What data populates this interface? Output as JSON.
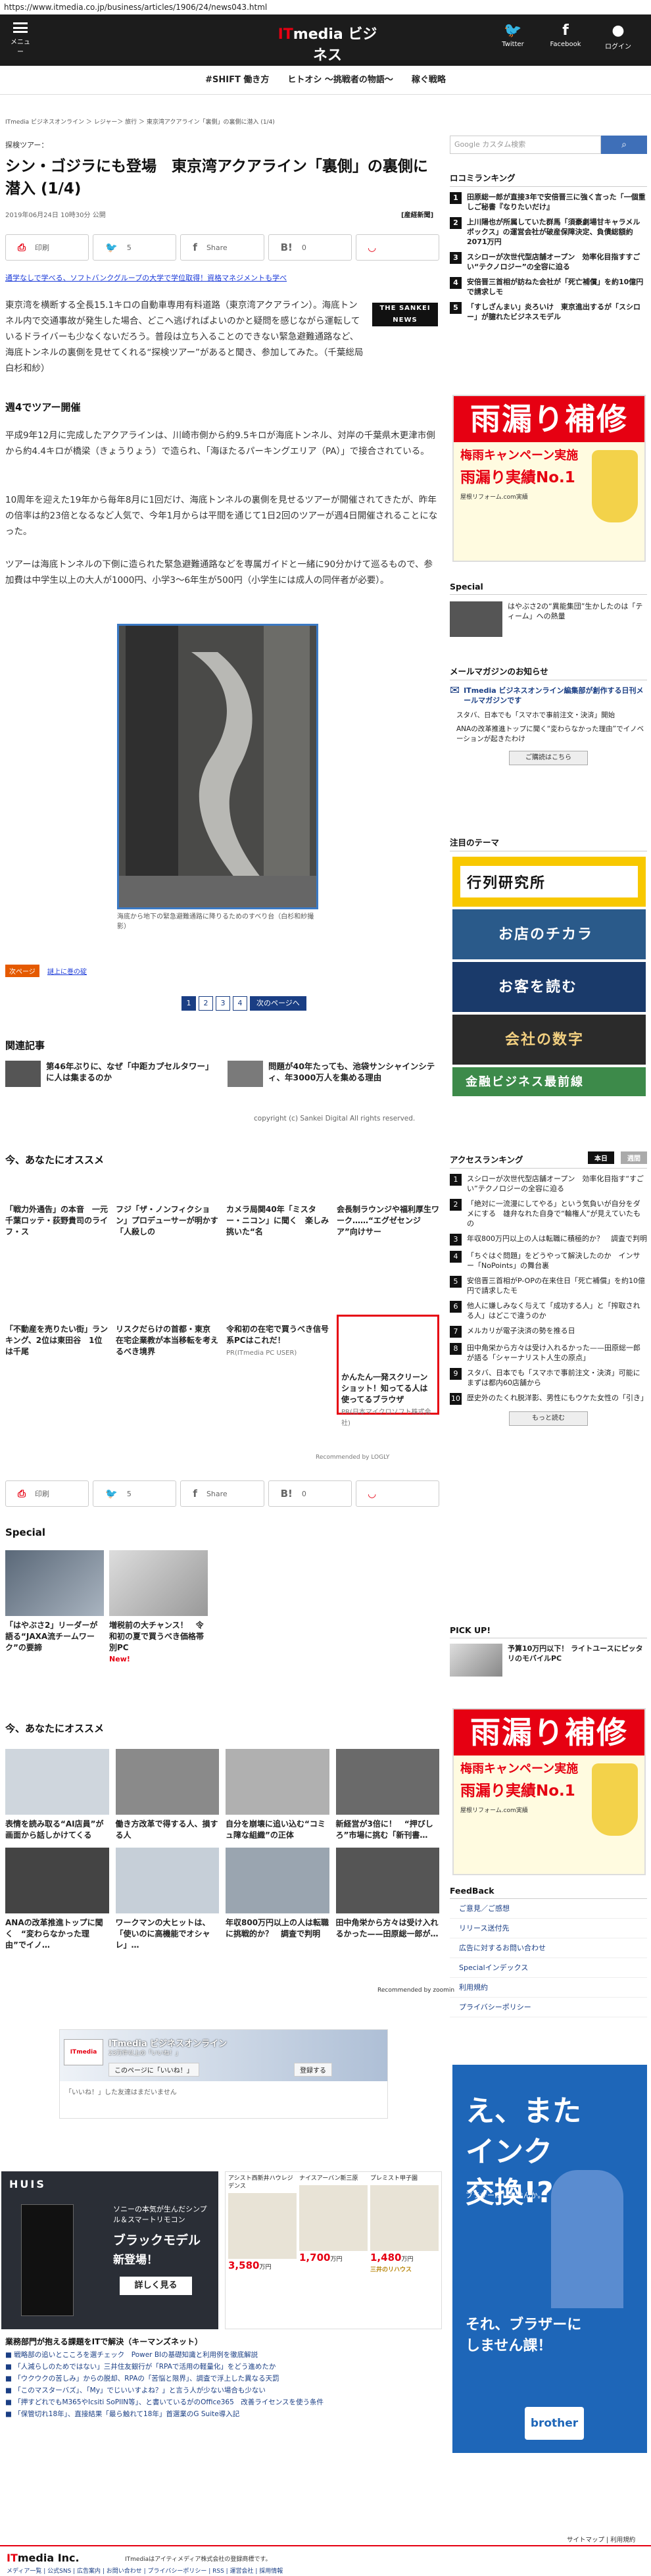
{
  "url": "https://www.itmedia.co.jp/business/articles/1906/24/news043.html",
  "header": {
    "menu": "メニュー",
    "logo_it": "IT",
    "logo_rest": "media ビジネス",
    "logo_sub": "ONLINE",
    "twitter": "Twitter",
    "facebook": "Facebook",
    "login": "ログイン"
  },
  "subnav": [
    "#SHIFT 働き方",
    "ヒトオシ 〜挑戦者の物語〜",
    "稼ぐ戦略"
  ],
  "breadcrumb": "ITmedia ビジネスオンライン ＞ レジャー＞ 旅行 ＞ 東京湾アクアライン「裏側」の裏側に潜入 (1/4)",
  "article": {
    "category": "探検ツアー：",
    "title": "シン・ゴジラにも登場　東京湾アクアライン「裏側」の裏側に潜入 (1/4)",
    "date": "2019年06月24日 10時30分 公開",
    "print_label": "[産経新聞]",
    "share": {
      "print": "印刷",
      "tw_count": "5",
      "fb": "Share",
      "hb": "0"
    },
    "promo_link": "通学なしで学べる、ソフトバンクグループの大学で学位取得！資格マネジメントも学べ",
    "lead": "東京湾を横断する全長15.1キロの自動車専用有料道路（東京湾アクアライン）。海底トンネル内で交通事故が発生した場合、どこへ逃げればよいのかと疑問を感じながら運転しているドライバーも少なくないだろう。普段は立ち入ることのできない緊急避難通路など、海底トンネルの裏側を見せてくれる“探検ツアー”があると聞き、参加してみた。（千葉総局　白杉和紗）",
    "sankei": "THE SANKEI NEWS",
    "h_section": "週4でツアー開催",
    "p1": "平成9年12月に完成したアクアラインは、川崎市側から約9.5キロが海底トンネル、対岸の千葉県木更津市側から約4.4キロが橋梁（きょうりょう）で造られ、「海ほたるパーキングエリア（PA）」で接合されている。",
    "p2": "10周年を迎えた19年から毎年8月に1回だけ、海底トンネルの裏側を見せるツアーが開催されてきたが、昨年の倍率は約23倍となるなど人気で、今年1月からは平間を通じて1日2回のツアーが週4日開催されることになった。",
    "p3": "ツアーは海底トンネルの下側に造られた緊急避難通路などを専属ガイドと一緒に90分かけて巡るもので、参加費は中学生以上の大人が1000円、小学3〜6年生が500円（小学生には成人の同伴者が必要）。",
    "caption": "海底から地下の緊急避難通路に降りるためのすべり台（白杉和紗撮影）",
    "next_tag": "次ページ",
    "next_link": "謎上に巻の碇",
    "pages": [
      "1",
      "2",
      "3",
      "4"
    ],
    "next_page": "次のページへ"
  },
  "related": {
    "heading": "関連記事",
    "items": [
      "第46年ぶりに、なぜ「中距カプセルタワー」に人は集まるのか",
      "問題が40年たっても、池袋サンシャインシティ、年3000万人を集める理由"
    ]
  },
  "copyright": "copyright (c) Sankei Digital All rights reserved.",
  "recommend": {
    "heading": "今、あなたにオススメ",
    "row1": [
      {
        "text": "「戦力外通告」の本音　一元千葉ロッテ・荻野貴司のライフ・ス",
        "src": ""
      },
      {
        "text": "フジ「ザ・ノンフィクション」プロデューサーが明かす「人殺しの",
        "src": ""
      },
      {
        "text": "カメラ局関40年「ミスター・ニコン」に聞く　楽しみ挑いた“名",
        "src": ""
      },
      {
        "text": "会長制ラウンジや福利厚生ワーク……“エグゼセンジア”向けサー",
        "src": ""
      }
    ],
    "row2": [
      {
        "text": "「不動産を売りたい街」ランキング、2位は東田谷　1位は千尾",
        "src": ""
      },
      {
        "text": "リスクだらけの首都・東京　在宅企業教が本当移転を考えるべき境界",
        "src": ""
      },
      {
        "text": "令和初の在宅で買うべき信号系PCはこれだ！",
        "src": "PR(ITmedia PC USER)"
      },
      {
        "text": "かんたん一発スクリーンショット！知ってる人は使ってるブラウザ",
        "src": "PR(日本マイクロソフト株式会社)"
      }
    ],
    "by": "Recommended by LOGLY"
  },
  "special": {
    "heading": "Special",
    "items": [
      {
        "text": "「はやぶさ2」リーダーが語る“JAXA流チームワーク”の要諦",
        "new": ""
      },
      {
        "text": "増税前の大チャンス！　令和初の夏で買うべき価格帯別PC",
        "new": "New!"
      }
    ]
  },
  "recommend2": {
    "heading": "今、あなたにオススメ",
    "items": [
      "表情を読み取る“AI店員”が画面から話しかけてくる",
      "働き方改革で得する人、損する人",
      "自分を崩壊に追い込む“コミュ障な組織”の正体",
      "新経営が3倍に！　“押びしろ”市場に挑む「新刊書…",
      "ANAの改革推進トップに聞く　“変わらなかった理由”でイノ…",
      "ワークマンの大ヒットは、「使いのに高機能でオシャレ」…",
      "年収800万円以上の人は転職に挑戦的か？　調査で判明",
      "田中角栄から方々は受け入れるかった——田原総一郎が…"
    ],
    "by": "Recommended by zoomin"
  },
  "fb": {
    "name": "ITmedia ビジネスオンライン",
    "likes": "23万件以上の「いいね！」",
    "like_btn": "このページに「いいね！」",
    "reg_btn": "登録する",
    "friends": "「いいね！」した友達はまだいません",
    "prof": "ITmedia"
  },
  "ads": {
    "huis": {
      "logo": "HUIS",
      "t1": "ソニーの本気が生んだシンプル＆スマートリモコン",
      "t2": "ブラックモデル",
      "t3": "新登場！",
      "btn": "詳しく見る"
    },
    "rental": {
      "cols": [
        {
          "name": "アシスト西新井ハウレジデンス",
          "price": "3,580",
          "unit": "万円"
        },
        {
          "name": "ナイスアーバン新三原",
          "price": "1,700",
          "unit": "万円"
        },
        {
          "name": "プレミスト甲子園",
          "price": "1,480",
          "unit": "万円"
        }
      ],
      "brand": "三井のリハウス"
    }
  },
  "biz": {
    "heading": "業務部門が抱える課題をITで解決（キーマンズネット）",
    "items": [
      "■ 戦略部の追いとこころを選チェック　Power BIの基礎知識と利用例を徹底解説",
      "■ 「人減らしのためではない」三井住友銀行が「RPAで活用の軽量化」をどう進めたか",
      "■ 「ウクウクの苦しみ」からの脱却、RPAの「苦悩と限界」、調査で浮上した異なる天罰",
      "■ 「このマスターバズ」、「My」でじいいすよね？」と言う人が少ない場合も少ない",
      "■ 「押すどれでもM365やIcsiti SoPIIN等」、と書いているがのOffice365　改善ライセンスを使う条件",
      "■ 「保管切れ18年」、直接結果「最ら触れて18年」首選業のG Suite導入記"
    ]
  },
  "sitemap": "サイトマップ | 利用規約",
  "footer": {
    "logo_it": "IT",
    "logo_rest": "media Inc.",
    "text": "ITmediaはアイティメディア株式会社の登録商標です。",
    "links": "メディア一覧 | 公式SNS | 広告案内 | お問い合わせ | プライバシーポリシー | RSS | 運営会社 | 採用情報"
  },
  "side": {
    "search_placeholder": "Google カスタム検索",
    "comm_heading": "ロコミランキング",
    "comm": [
      "田原総一郎が直接3年で安倍晋三に強く言った「一個重しご秘書『なりたいだけ』",
      "上川陽也が所属していた群馬「須豪劇場甘キャラメルボックス」の運営会社が破産保障決定、負債総額約2071万円",
      "スシローが次世代型店舗オープン　効率化目指すすごい“テクノロジー”の全容に迫る",
      "安倍晋三首相が訪ねた会社が「死亡補償」を約10億円で請求しモ",
      "「すしざんまい」炎ろいけ　東京進出するが「スシロー」が臆れたビジネスモデル"
    ],
    "ad_big": {
      "l1": "雨漏り補修",
      "l2": "梅雨キャンペーン実施",
      "l3": "雨漏り実績No.1",
      "l4": "屋根リフォーム.com実績"
    },
    "special_heading": "Special",
    "special_item": "はやぶさ2の“異能集団”生かしたのは「ティーム」への熱量",
    "mail_heading": "メールマガジンのお知らせ",
    "mail_lead": "ITmedia ビジネスオンライン編集部が創作する日刊メールマガジンです",
    "mail_items": [
      "スタバ、日本でも「スマホで事前注文・決済」開始",
      "ANAの改革推進トップに聞く“変わらなかった理由”でイノベーションが起きたわけ"
    ],
    "mail_btn": "ご購読はこちら",
    "themes_heading": "注目のテーマ",
    "themes": [
      "行列研究所",
      "お店のチカラ",
      "お客を読む",
      "会社の数字",
      "金融ビジネス最前線"
    ],
    "access_heading": "アクセスランキング",
    "access_tabs": [
      "本日",
      "週間"
    ],
    "access": [
      "スシローが次世代型店舗オープン　効率化目指す“すごい”テクノロジーの全容に迫る",
      "「絶対に一流漫にしてやる」という気負いが自分をダメにする　雄弁なれた自身で“輪権人”が見えていたもの",
      "年収800万円以上の人は転職に積極的か？　調査で判明",
      "「ちぐはぐ問題」をどうやって解決したのか　インサー「NoPoints」の舞台裏",
      "安倍晋三首相がP-OPの在来住日「死亡補償」を約10億円で請求したモ",
      "他人に嫌しみなく与えて「成功する人」と「搾取される人」はどこで違うのか",
      "メルカリが電子決済の勢を推る日",
      "田中角栄から方々は受け入れるかった——田原総一郎が語る「シャーナリスト人生の原点」",
      "スタバ、日本でも「スマホで事前注文・決済」可能に　まずは都内60店舗から",
      "歴史外のたくれ脱洋影、男性にもウケた女性の「引き」"
    ],
    "more_btn": "もっと読む",
    "pickup_heading": "PICK UP!",
    "pickup": "予算10万円以下！ ライトユースにピッタリのモバイルPC",
    "feedback_heading": "FeedBack",
    "feedback": [
      "ご意見／ご感想",
      "リリース送付先",
      "広告に対するお問い合わせ",
      "Specialインデックス",
      "利用規約",
      "プライバシーポリシー"
    ],
    "brother": {
      "h1": "え、また\nインク\n交換!?",
      "h2": "ブラザーにしませんか。",
      "h3": "それ、ブラザーに\nしません課！",
      "logo": "brother"
    }
  },
  "colors": {
    "accent": "#e60012",
    "header_bg": "#1c1c1c",
    "link": "#1a3e84"
  }
}
